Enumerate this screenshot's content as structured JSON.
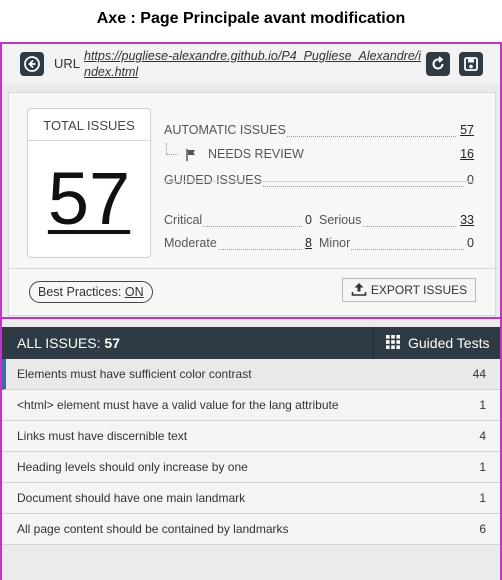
{
  "caption": "Axe : Page Principale avant modification",
  "urlbar": {
    "label": "URL",
    "url": "https://pugliese-alexandre.github.io/P4_Pugliese_Alexandre/index.html"
  },
  "summary": {
    "total_label": "TOTAL ISSUES",
    "total_value": "57",
    "automatic_label": "AUTOMATIC ISSUES",
    "automatic_value": "57",
    "needs_review_label": "NEEDS REVIEW",
    "needs_review_value": "16",
    "guided_label": "GUIDED ISSUES",
    "guided_value": "0",
    "critical_label": "Critical",
    "critical_value": "0",
    "serious_label": "Serious",
    "serious_value": "33",
    "moderate_label": "Moderate",
    "moderate_value": "8",
    "minor_label": "Minor",
    "minor_value": "0",
    "best_practices_label": "Best Practices:",
    "best_practices_value": "ON",
    "export_label": "EXPORT ISSUES"
  },
  "issues_header": {
    "label": "ALL ISSUES:",
    "count": "57",
    "guided_tests_label": "Guided Tests"
  },
  "issues": [
    {
      "text": "Elements must have sufficient color contrast",
      "count": "44"
    },
    {
      "text": "<html> element must have a valid value for the lang attribute",
      "count": "1"
    },
    {
      "text": "Links must have discernible text",
      "count": "4"
    },
    {
      "text": "Heading levels should only increase by one",
      "count": "1"
    },
    {
      "text": "Document should have one main landmark",
      "count": "1"
    },
    {
      "text": "All page content should be contained by landmarks",
      "count": "6"
    }
  ],
  "colors": {
    "header_dark": "#2e3a44",
    "highlight_border": "#c035c6",
    "active_accent": "#3a6ea5"
  }
}
